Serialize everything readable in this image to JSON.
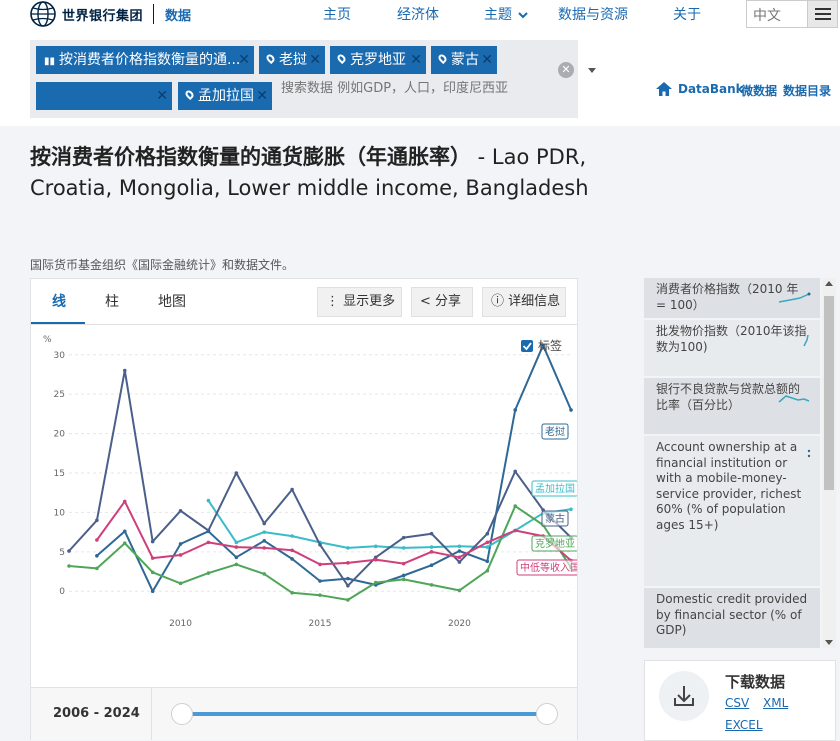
{
  "nav": {
    "logo_text": "世界银行集团",
    "data_label": "数据",
    "links": [
      "主页",
      "经济体",
      "主题",
      "数据与资源",
      "关于"
    ],
    "language": "中文"
  },
  "filters": {
    "chips": [
      {
        "label": "按消费者价格指数衡量的通...",
        "kind": "indicator"
      },
      {
        "label": "老挝",
        "kind": "country"
      },
      {
        "label": "克罗地亚",
        "kind": "country"
      },
      {
        "label": "蒙古",
        "kind": "country"
      },
      {
        "label": "",
        "kind": "aggregate"
      },
      {
        "label": "孟加拉国",
        "kind": "country"
      }
    ],
    "search_placeholder": "搜索数据 例如GDP，人口，印度尼西亚",
    "databank": "DataBank",
    "microdata": "微数据",
    "catalog": "数据目录"
  },
  "page": {
    "title_cn": "按消费者价格指数衡量的通货膨胀（年通胀率）",
    "title_en": " - Lao PDR, Croatia, Mongolia, Lower middle income, Bangladesh",
    "source": "国际货币基金组织《国际金融统计》和数据文件。"
  },
  "tabs": [
    "线",
    "柱",
    "地图"
  ],
  "toolbar": {
    "more": "显示更多",
    "share": "分享",
    "details": "详细信息"
  },
  "labels_toggle": "标签",
  "range": "2006 - 2024",
  "side_panel": [
    "消费者价格指数（2010 年 = 100）",
    "批发物价指数（2010年该指数为100)",
    "银行不良贷款与贷款总额的比率（百分比）",
    "Account ownership at a financial institution or with a mobile-money-service provider, richest 60% (% of population ages 15+)",
    "Domestic credit provided by financial sector (% of GDP)"
  ],
  "download": {
    "title": "下载数据",
    "csv": "CSV",
    "xml": "XML",
    "excel": "EXCEL"
  },
  "chart_data": {
    "type": "line",
    "ylabel": "%",
    "xlim": [
      2006,
      2024
    ],
    "ylim": [
      -2,
      32
    ],
    "yticks": [
      0,
      5,
      10,
      15,
      20,
      25,
      30
    ],
    "xticks": [
      2010,
      2015,
      2020
    ],
    "grid": true,
    "series": [
      {
        "name": "老挝",
        "color": "#2e6896",
        "x": [
          2007,
          2008,
          2009,
          2010,
          2011,
          2012,
          2013,
          2014,
          2015,
          2016,
          2017,
          2018,
          2019,
          2020,
          2021,
          2022,
          2023,
          2024
        ],
        "values": [
          4.5,
          7.6,
          0.0,
          6.0,
          7.6,
          4.3,
          6.4,
          4.1,
          1.3,
          1.6,
          0.8,
          2.0,
          3.3,
          5.1,
          3.8,
          23.0,
          31.2,
          23.0
        ]
      },
      {
        "name": "孟加拉国",
        "color": "#3bbbc8",
        "x": [
          2011,
          2012,
          2013,
          2014,
          2015,
          2016,
          2017,
          2018,
          2019,
          2020,
          2021,
          2022,
          2023,
          2024
        ],
        "values": [
          11.5,
          6.2,
          7.5,
          7.0,
          6.2,
          5.5,
          5.7,
          5.5,
          5.6,
          5.7,
          5.6,
          7.7,
          9.9,
          10.4
        ]
      },
      {
        "name": "蒙古",
        "color": "#4a5f8a",
        "x": [
          2006,
          2007,
          2008,
          2009,
          2010,
          2011,
          2012,
          2013,
          2014,
          2015,
          2016,
          2017,
          2018,
          2019,
          2020,
          2021,
          2022,
          2023,
          2024
        ],
        "values": [
          5.1,
          9.0,
          28.0,
          6.3,
          10.2,
          7.7,
          15.0,
          8.6,
          12.9,
          5.9,
          0.7,
          4.3,
          6.8,
          7.3,
          3.7,
          7.3,
          15.2,
          10.3,
          6.8
        ]
      },
      {
        "name": "克罗地亚",
        "color": "#4fa65a",
        "x": [
          2006,
          2007,
          2008,
          2009,
          2010,
          2011,
          2012,
          2013,
          2014,
          2015,
          2016,
          2017,
          2018,
          2019,
          2020,
          2021,
          2022,
          2023,
          2024
        ],
        "values": [
          3.2,
          2.9,
          6.1,
          2.4,
          1.0,
          2.3,
          3.4,
          2.2,
          -0.2,
          -0.5,
          -1.1,
          1.1,
          1.5,
          0.8,
          0.1,
          2.6,
          10.8,
          8.4,
          3.0
        ]
      },
      {
        "name": "中低等收入国家",
        "color": "#cf3f7a",
        "x": [
          2007,
          2008,
          2009,
          2010,
          2011,
          2012,
          2013,
          2014,
          2015,
          2016,
          2017,
          2018,
          2019,
          2020,
          2021,
          2022,
          2023,
          2024
        ],
        "values": [
          6.5,
          11.4,
          4.2,
          4.6,
          6.2,
          5.6,
          5.5,
          5.2,
          3.4,
          3.6,
          4.0,
          3.5,
          5.0,
          4.3,
          6.2,
          7.7,
          7.0,
          3.9
        ]
      }
    ],
    "end_labels": [
      "老挝",
      "孟加拉国",
      "蒙古",
      "克罗地亚",
      "中低等收入国家"
    ]
  }
}
